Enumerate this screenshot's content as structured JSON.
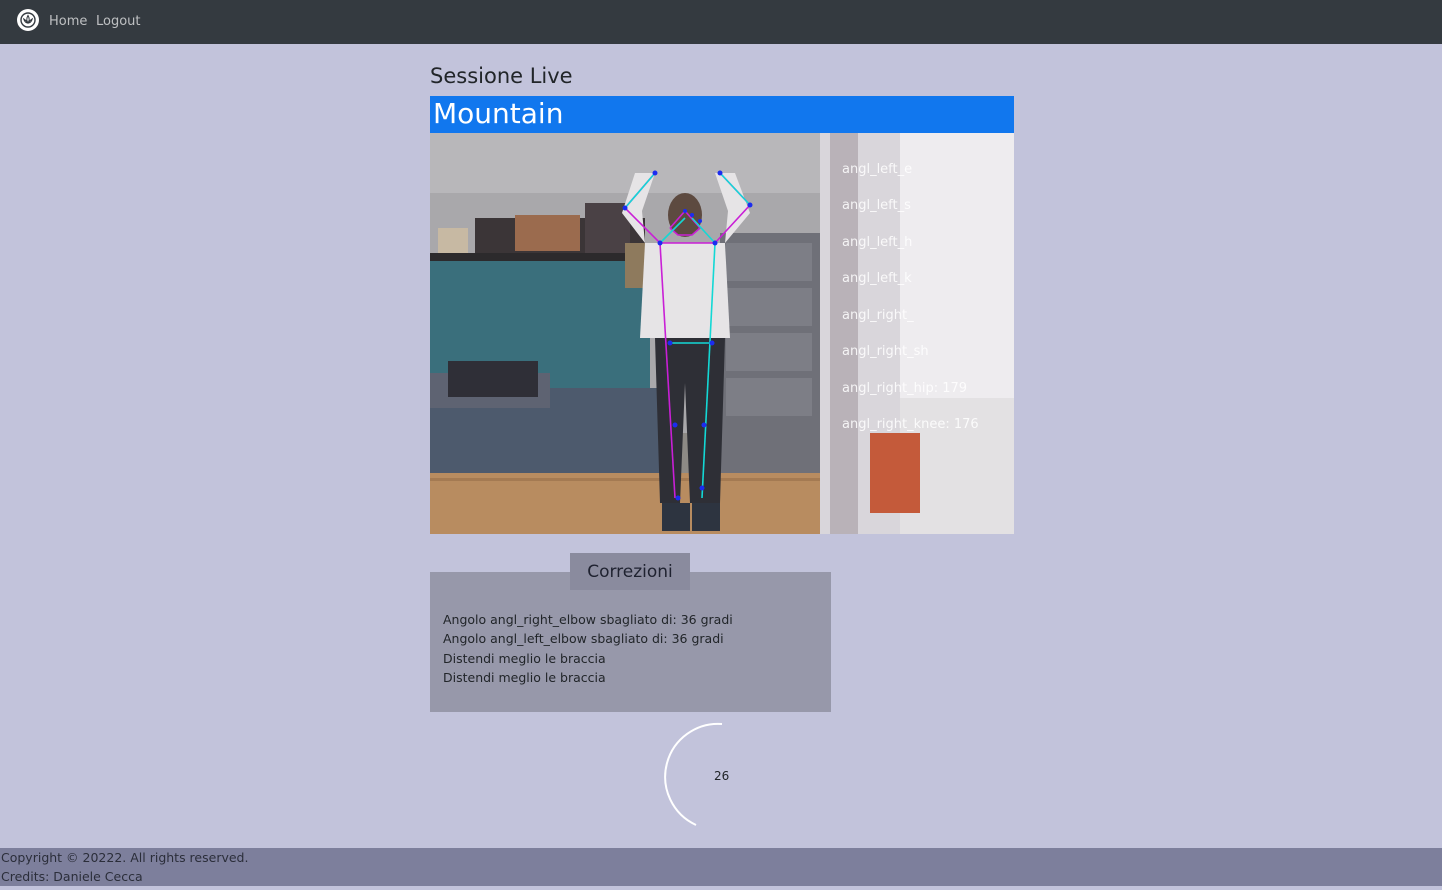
{
  "navbar": {
    "logo_icon": "lotus-icon",
    "links": [
      {
        "label": "Home"
      },
      {
        "label": "Logout"
      }
    ]
  },
  "page": {
    "title": "Sessione Live"
  },
  "video": {
    "pose_name": "Mountain",
    "overlay_labels": [
      "angl_left_e",
      "angl_left_s",
      "angl_left_h",
      "angl_left_k",
      "angl_right_",
      "angl_right_sh",
      "angl_right_hip:  179",
      "angl_right_knee:  176"
    ],
    "bar_color": "#1177ee"
  },
  "corrections": {
    "title": "Correzioni",
    "items": [
      "Angolo angl_right_elbow sbagliato di: 36 gradi",
      "Angolo angl_left_elbow sbagliato di: 36 gradi",
      "Distendi meglio le braccia",
      "Distendi meglio le braccia"
    ]
  },
  "timer": {
    "value": "26"
  },
  "footer": {
    "copyright": "Copyright © 20222. All rights reserved.",
    "credits": "Credits: Daniele Cecca"
  }
}
